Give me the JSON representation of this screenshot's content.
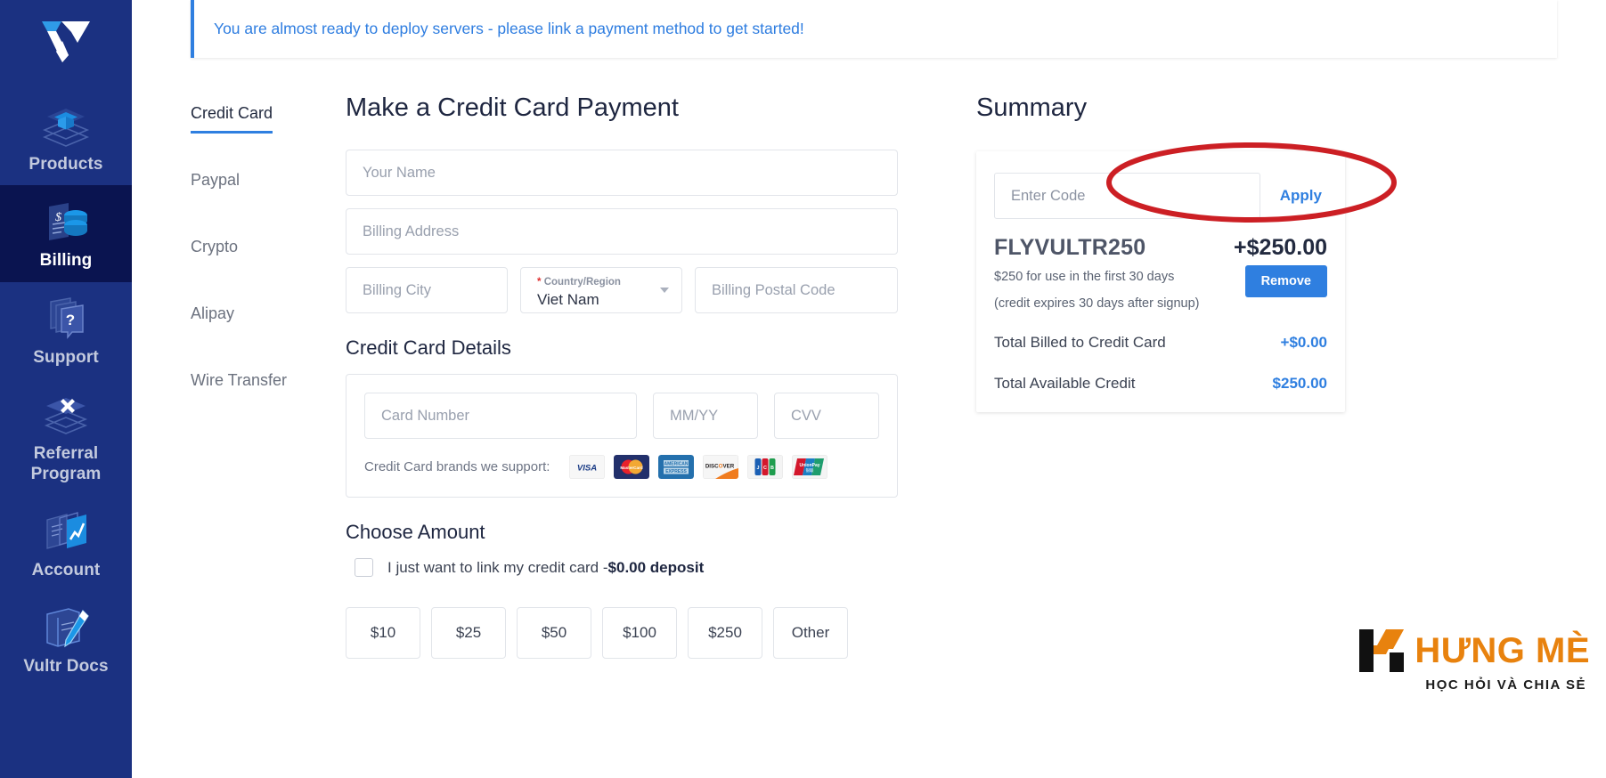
{
  "sidebar": {
    "logo_name": "vultr-logo",
    "items": [
      {
        "label": "Products",
        "icon": "layers-cube-icon",
        "active": false
      },
      {
        "label": "Billing",
        "icon": "invoice-coins-icon",
        "active": true
      },
      {
        "label": "Support",
        "icon": "layers-question-icon",
        "active": false
      },
      {
        "label": "Referral Program",
        "icon": "layers-x-icon",
        "active": false
      },
      {
        "label": "Account",
        "icon": "documents-chart-icon",
        "active": false
      },
      {
        "label": "Vultr Docs",
        "icon": "book-pencil-icon",
        "active": false
      }
    ],
    "collapse_arrow": "collapse-sidebar-arrow"
  },
  "alert": {
    "message": "You are almost ready to deploy servers - please link a payment method to get started!",
    "accent_color": "#2f7fe0"
  },
  "payment_tabs": [
    {
      "label": "Credit Card",
      "active": true
    },
    {
      "label": "Paypal",
      "active": false
    },
    {
      "label": "Crypto",
      "active": false
    },
    {
      "label": "Alipay",
      "active": false
    },
    {
      "label": "Wire Transfer",
      "active": false
    }
  ],
  "form": {
    "title": "Make a Credit Card Payment",
    "name_placeholder": "Your Name",
    "name_value": "",
    "address_placeholder": "Billing Address",
    "address_value": "",
    "city_placeholder": "Billing City",
    "city_value": "",
    "country_label": "Country/Region",
    "country_required_mark": "*",
    "country_value": "Viet Nam",
    "postal_placeholder": "Billing Postal Code",
    "postal_value": "",
    "card_details_title": "Credit Card Details",
    "card_number_placeholder": "Card Number",
    "card_number_value": "",
    "expiry_placeholder": "MM/YY",
    "expiry_value": "",
    "cvv_placeholder": "CVV",
    "cvv_value": "",
    "brands_label": "Credit Card brands we support:",
    "brands": [
      "VISA",
      "MasterCard",
      "AMERICAN EXPRESS",
      "DISCOVER",
      "JCB",
      "UnionPay"
    ],
    "amount_title": "Choose Amount",
    "link_card_text": "I just want to link my credit card -",
    "link_card_deposit": "$0.00 deposit",
    "link_card_checked": false,
    "amount_buttons": [
      "$10",
      "$25",
      "$50",
      "$100",
      "$250",
      "Other"
    ]
  },
  "summary": {
    "title": "Summary",
    "code_placeholder": "Enter Code",
    "code_value": "",
    "apply_label": "Apply",
    "promo_code": "FLYVULTR250",
    "promo_amount": "+$250.00",
    "promo_desc": "$250 for use in the first 30 days",
    "promo_desc2": "(credit expires 30 days after signup)",
    "remove_label": "Remove",
    "totals": [
      {
        "label": "Total Billed to Credit Card",
        "value": "+$0.00"
      },
      {
        "label": "Total Available Credit",
        "value": "$250.00"
      }
    ],
    "accent_color": "#2f7fe0"
  },
  "annotation": {
    "ellipse_color": "#cc1f24",
    "target": "enter-code-input"
  },
  "watermark": {
    "title": "HƯNG MÈ",
    "subtitle": "HỌC HỎI VÀ CHIA SẺ",
    "color": "#e8820e"
  }
}
